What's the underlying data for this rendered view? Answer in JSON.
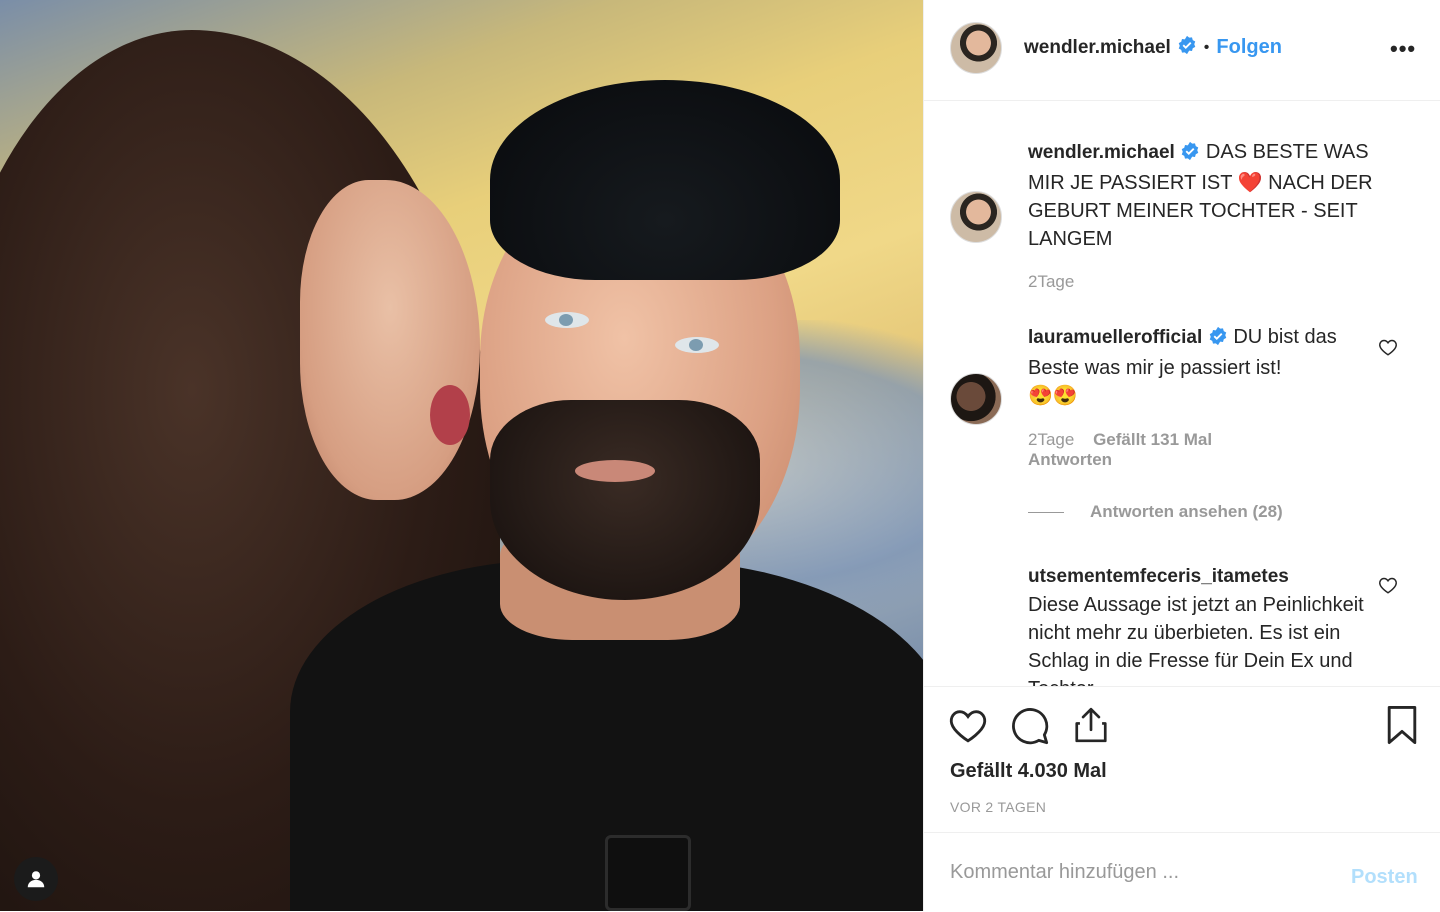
{
  "post": {
    "author": "wendler.michael",
    "follow_label": "Folgen",
    "more_label": "•••",
    "bullet": "•"
  },
  "caption": {
    "author": "wendler.michael",
    "text_part1": "DAS BESTE WAS MIR JE PASSIERT IST",
    "emoji": "❤️",
    "text_part2": "NACH DER GEBURT MEINER TOCHTER - SEIT LANGEM",
    "age": "2Tage"
  },
  "comments": [
    {
      "author": "lauramuellerofficial",
      "text": "DU bist das Beste was mir je passiert ist!",
      "emoji": "😍😍",
      "age": "2Tage",
      "likes": "Gefällt 131 Mal",
      "reply": "Antworten"
    },
    {
      "author": "utsementemfeceris_itametes",
      "text": "Diese Aussage ist jetzt an Peinlichkeit nicht mehr zu überbieten. Es ist ein Schlag in die Fresse für Dein Ex und Tochter"
    }
  ],
  "view_replies": "Antworten ansehen (28)",
  "likes_total": "Gefällt 4.030 Mal",
  "posted_ago": "VOR 2 TAGEN",
  "composer": {
    "placeholder": "Kommentar hinzufügen ...",
    "post_label": "Posten"
  },
  "colors": {
    "accent": "#3897f0",
    "muted": "#999999",
    "post_disabled": "#b2dffc",
    "heart_emoji": "#e0141f"
  }
}
